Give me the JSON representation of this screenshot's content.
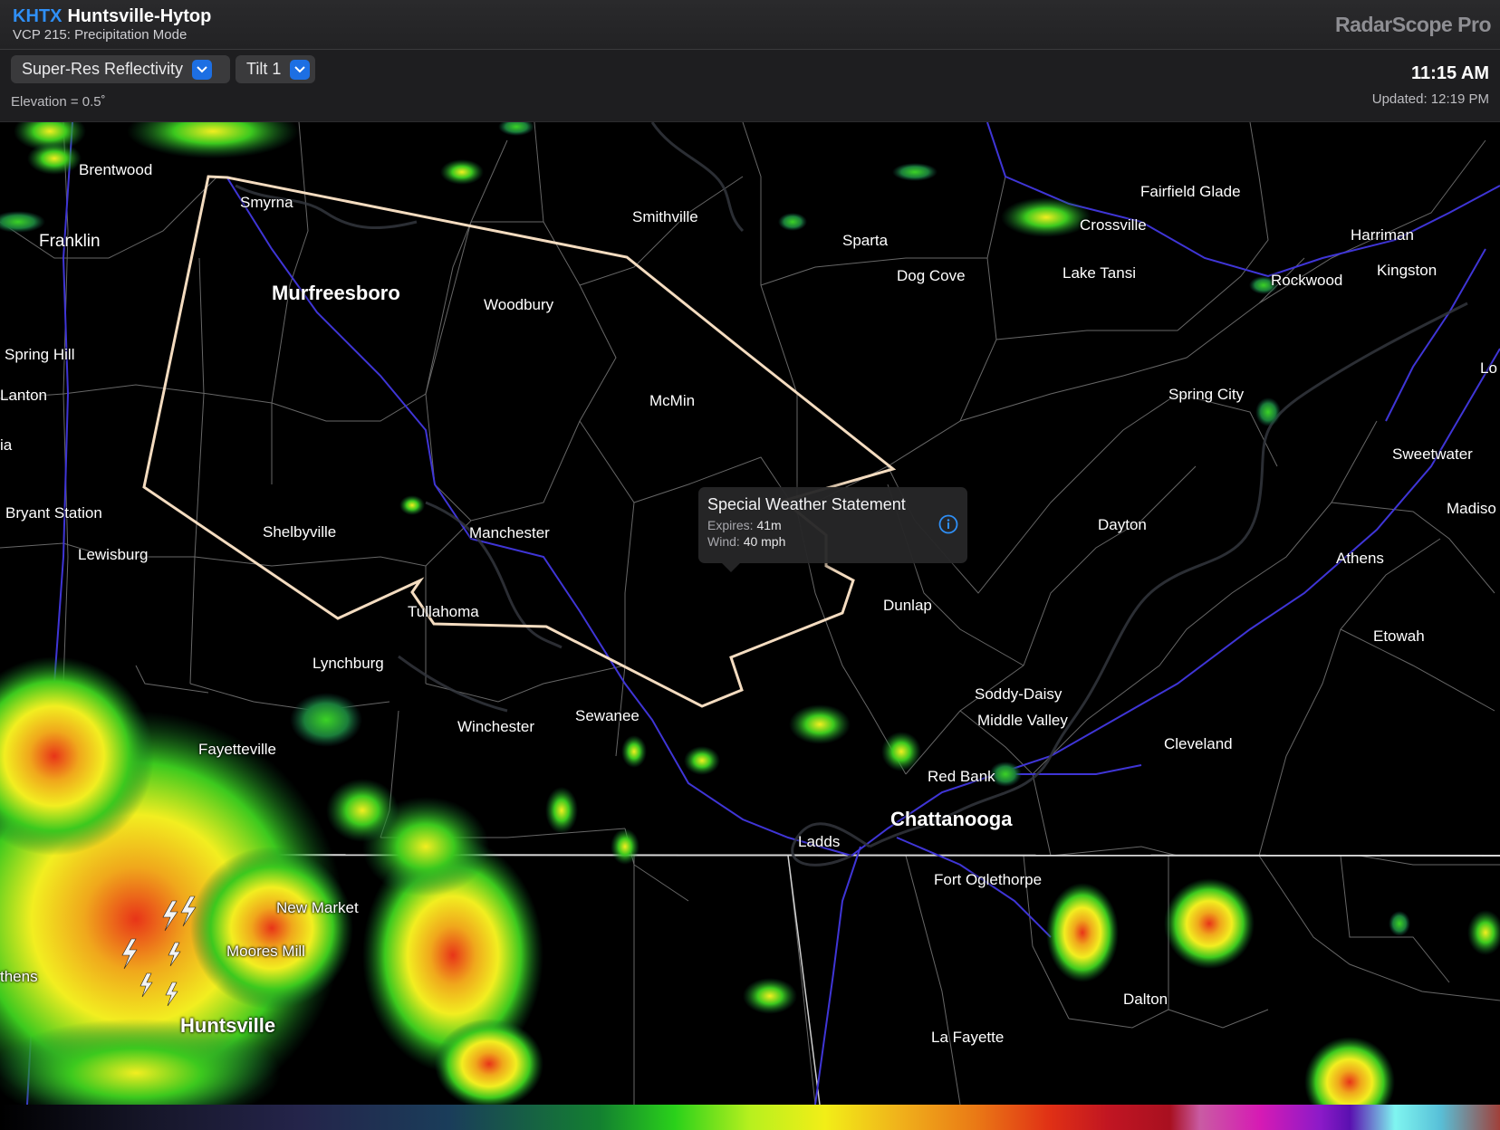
{
  "header": {
    "station_code": "KHTX",
    "station_name": "Huntsville-Hytop",
    "vcp": "VCP 215: Precipitation Mode",
    "brand": "RadarScope Pro"
  },
  "toolbar": {
    "product": "Super-Res Reflectivity",
    "tilt": "Tilt 1",
    "elevation": "Elevation = 0.5˚",
    "time": "11:15 AM",
    "updated": "Updated: 12:19 PM"
  },
  "popup": {
    "title": "Special Weather Statement",
    "expires_label": "Expires:",
    "expires_value": "41m",
    "wind_label": "Wind:",
    "wind_value": "40 mph"
  },
  "cities": {
    "brentwood": "Brentwood",
    "smyrna": "Smyrna",
    "franklin": "Franklin",
    "murfreesboro": "Murfreesboro",
    "spring_hill": "Spring Hill",
    "lanton": "Lanton",
    "ia": "ia",
    "bryant_station": "Bryant Station",
    "lewisburg": "Lewisburg",
    "shelbyville": "Shelbyville",
    "smithville": "Smithville",
    "woodbury": "Woodbury",
    "mcmin": "McMin",
    "manchester": "Manchester",
    "tullahoma": "Tullahoma",
    "lynchburg": "Lynchburg",
    "winchester": "Winchester",
    "sewanee": "Sewanee",
    "fayetteville": "Fayetteville",
    "new_market": "New Market",
    "moores_mill": "Moores Mill",
    "huntsville": "Huntsville",
    "thens": "thens",
    "sparta": "Sparta",
    "dog_cove": "Dog Cove",
    "fairfield_glade": "Fairfield Glade",
    "crossville": "Crossville",
    "lake_tansi": "Lake Tansi",
    "harriman": "Harriman",
    "rockwood": "Rockwood",
    "kingston": "Kingston",
    "lo": "Lo",
    "spring_city": "Spring City",
    "sweetwater": "Sweetwater",
    "madiso": "Madiso",
    "dayton": "Dayton",
    "athens": "Athens",
    "dunlap": "Dunlap",
    "etowah": "Etowah",
    "soddy_daisy": "Soddy-Daisy",
    "middle_valley": "Middle Valley",
    "cleveland": "Cleveland",
    "red_bank": "Red Bank",
    "chattanooga": "Chattanooga",
    "ladds": "Ladds",
    "fort_oglethorpe": "Fort Oglethorpe",
    "dalton": "Dalton",
    "la_fayette": "La Fayette"
  },
  "icons": {
    "dropdown": "chevron-down-icon",
    "info": "info-icon",
    "lightning": "lightning-icon"
  },
  "colors": {
    "accent": "#2f8ff6",
    "warning_polygon": "#f4dcc0",
    "highways": "#3f35d6"
  }
}
